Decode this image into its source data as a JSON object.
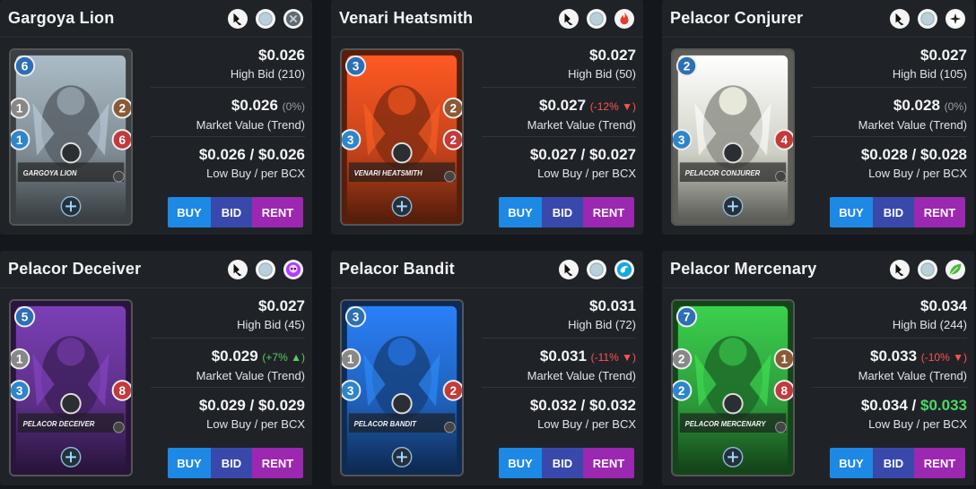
{
  "cards": [
    {
      "name": "Gargoya Lion",
      "icons": [
        "melee-icon",
        "neutral-icon",
        "no-ability-icon"
      ],
      "element_icon": "no-ability-icon",
      "theme": "#7f8b93",
      "mana": "6",
      "attack": "1",
      "speed": "1",
      "armor": "2",
      "health": "6",
      "art_name": "GARGOYA LION",
      "price": "$0.026",
      "high_bid": "High Bid (210)",
      "market_value": "$0.026",
      "trend": "(0%)",
      "trend_dir": "neutral",
      "market_label": "Market Value (Trend)",
      "low_buy": "$0.026",
      "per_bcx": "$0.026",
      "per_bcx_color": "normal",
      "low_label": "Low Buy / per BCX",
      "buy": "BUY",
      "bid": "BID",
      "rent": "RENT"
    },
    {
      "name": "Venari Heatsmith",
      "icons": [
        "melee-icon",
        "neutral-icon",
        "fire-icon"
      ],
      "theme": "#c1421a",
      "mana": "3",
      "attack": "",
      "speed": "3",
      "armor": "2",
      "health": "2",
      "art_name": "VENARI HEATSMITH",
      "price": "$0.027",
      "high_bid": "High Bid (50)",
      "market_value": "$0.027",
      "trend": "(-12%",
      "trend_dir": "down",
      "market_label": "Market Value (Trend)",
      "low_buy": "$0.027",
      "per_bcx": "$0.027",
      "per_bcx_color": "normal",
      "low_label": "Low Buy / per BCX",
      "buy": "BUY",
      "bid": "BID",
      "rent": "RENT"
    },
    {
      "name": "Pelacor Conjurer",
      "icons": [
        "melee-icon",
        "neutral-icon",
        "life-icon"
      ],
      "theme": "#cfd0c4",
      "mana": "2",
      "attack": "",
      "speed": "3",
      "armor": "",
      "health": "4",
      "art_name": "PELACOR CONJURER",
      "price": "$0.027",
      "high_bid": "High Bid (105)",
      "market_value": "$0.028",
      "trend": "(0%)",
      "trend_dir": "neutral",
      "market_label": "Market Value (Trend)",
      "low_buy": "$0.028",
      "per_bcx": "$0.028",
      "per_bcx_color": "normal",
      "low_label": "Low Buy / per BCX",
      "buy": "BUY",
      "bid": "BID",
      "rent": "RENT"
    },
    {
      "name": "Pelacor Deceiver",
      "icons": [
        "melee-icon",
        "neutral-icon",
        "death-icon"
      ],
      "theme": "#5b2f86",
      "mana": "5",
      "attack": "1",
      "speed": "3",
      "armor": "",
      "health": "8",
      "art_name": "PELACOR DECEIVER",
      "price": "$0.027",
      "high_bid": "High Bid (45)",
      "market_value": "$0.029",
      "trend": "(+7%",
      "trend_dir": "up",
      "market_label": "Market Value (Trend)",
      "low_buy": "$0.029",
      "per_bcx": "$0.029",
      "per_bcx_color": "normal",
      "low_label": "Low Buy / per BCX",
      "buy": "BUY",
      "bid": "BID",
      "rent": "RENT"
    },
    {
      "name": "Pelacor Bandit",
      "icons": [
        "melee-icon",
        "neutral-icon",
        "water-icon"
      ],
      "theme": "#1f5fb8",
      "mana": "3",
      "attack": "1",
      "speed": "3",
      "armor": "",
      "health": "2",
      "art_name": "PELACOR BANDIT",
      "price": "$0.031",
      "high_bid": "High Bid (72)",
      "market_value": "$0.031",
      "trend": "(-11%",
      "trend_dir": "down",
      "market_label": "Market Value (Trend)",
      "low_buy": "$0.032",
      "per_bcx": "$0.032",
      "per_bcx_color": "normal",
      "low_label": "Low Buy / per BCX",
      "buy": "BUY",
      "bid": "BID",
      "rent": "RENT"
    },
    {
      "name": "Pelacor Mercenary",
      "icons": [
        "melee-icon",
        "neutral-icon",
        "earth-icon"
      ],
      "theme": "#2c9a3a",
      "mana": "7",
      "attack": "2",
      "speed": "2",
      "armor": "1",
      "health": "8",
      "art_name": "PELACOR MERCENARY",
      "price": "$0.034",
      "high_bid": "High Bid (244)",
      "market_value": "$0.033",
      "trend": "(-10%",
      "trend_dir": "down",
      "market_label": "Market Value (Trend)",
      "low_buy": "$0.034",
      "per_bcx": "$0.033",
      "per_bcx_color": "green",
      "low_label": "Low Buy / per BCX",
      "buy": "BUY",
      "bid": "BID",
      "rent": "RENT"
    }
  ],
  "trend_close": ")",
  "slash": " / ",
  "colors": {
    "buy": "#1e88e5",
    "bid": "#3949ab",
    "rent": "#9c27b0",
    "trend_down": "#ff5252",
    "trend_up": "#5ccb5f",
    "price_green": "#4cd964"
  }
}
